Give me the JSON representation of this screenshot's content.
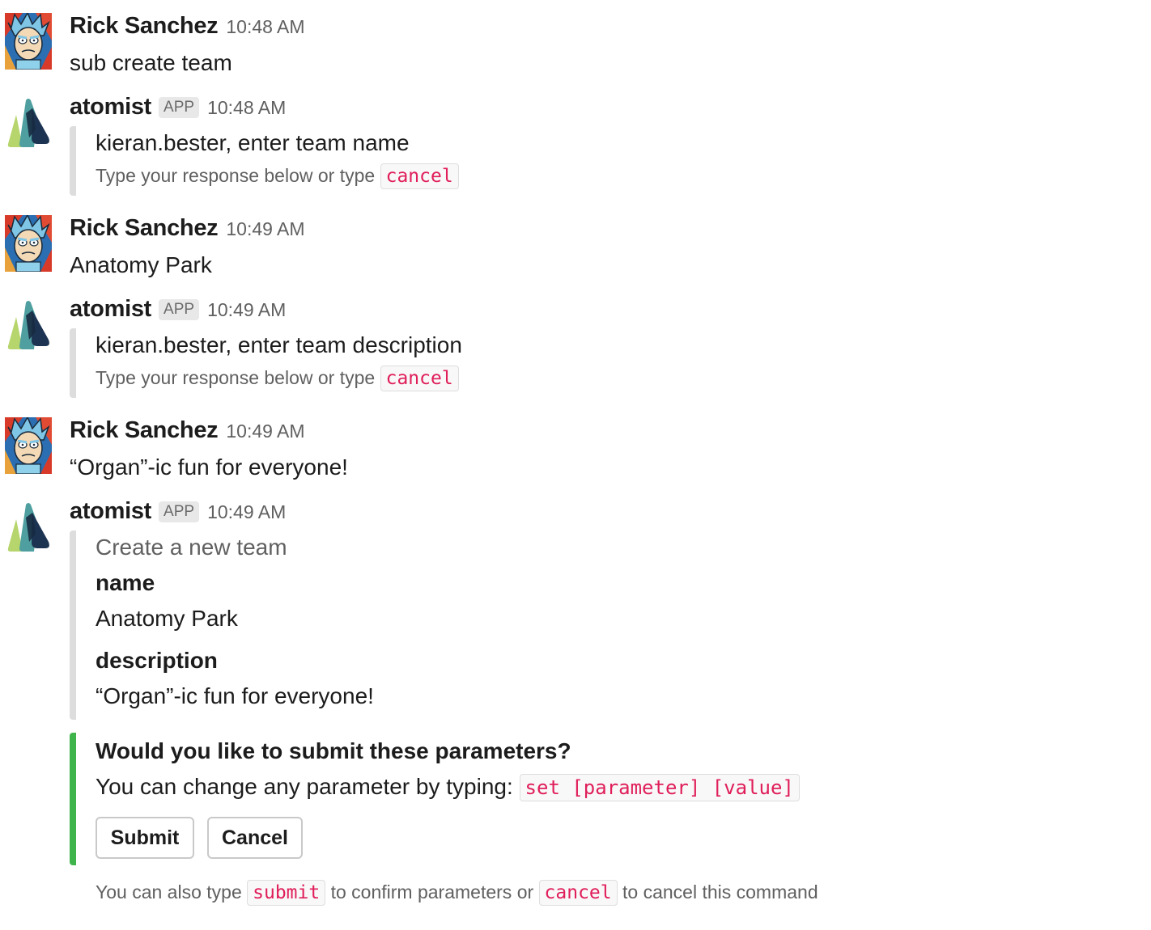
{
  "messages": [
    {
      "user": "Rick Sanchez",
      "time": "10:48 AM",
      "text": "sub create team",
      "avatar_icon": "rick-avatar-icon"
    },
    {
      "user": "atomist",
      "badge": "APP",
      "time": "10:48 AM",
      "prompt": "kieran.bester, enter team name",
      "hint": "Type your response below or type",
      "cancel_code": "cancel",
      "avatar_icon": "atomist-logo-icon"
    },
    {
      "user": "Rick Sanchez",
      "time": "10:49 AM",
      "text": "Anatomy Park",
      "avatar_icon": "rick-avatar-icon"
    },
    {
      "user": "atomist",
      "badge": "APP",
      "time": "10:49 AM",
      "prompt": "kieran.bester, enter team description",
      "hint": "Type your response below or type",
      "cancel_code": "cancel",
      "avatar_icon": "atomist-logo-icon"
    },
    {
      "user": "Rick Sanchez",
      "time": "10:49 AM",
      "text": "“Organ”-ic fun for everyone!",
      "avatar_icon": "rick-avatar-icon"
    },
    {
      "user": "atomist",
      "badge": "APP",
      "time": "10:49 AM",
      "avatar_icon": "atomist-logo-icon"
    }
  ],
  "summary": {
    "title": "Create a new team",
    "fields": [
      {
        "label": "name",
        "value": "Anatomy Park"
      },
      {
        "label": "description",
        "value": "“Organ”-ic fun for everyone!"
      }
    ]
  },
  "confirm": {
    "question": "Would you like to submit these parameters?",
    "change_text": "You can change any parameter by typing:",
    "change_code": "set [parameter] [value]",
    "submit_label": "Submit",
    "cancel_label": "Cancel",
    "accent_color": "#3fb44a"
  },
  "footer": {
    "part1": "You can also type",
    "code1": "submit",
    "part2": "to confirm parameters or",
    "code2": "cancel",
    "part3": "to cancel this command"
  }
}
